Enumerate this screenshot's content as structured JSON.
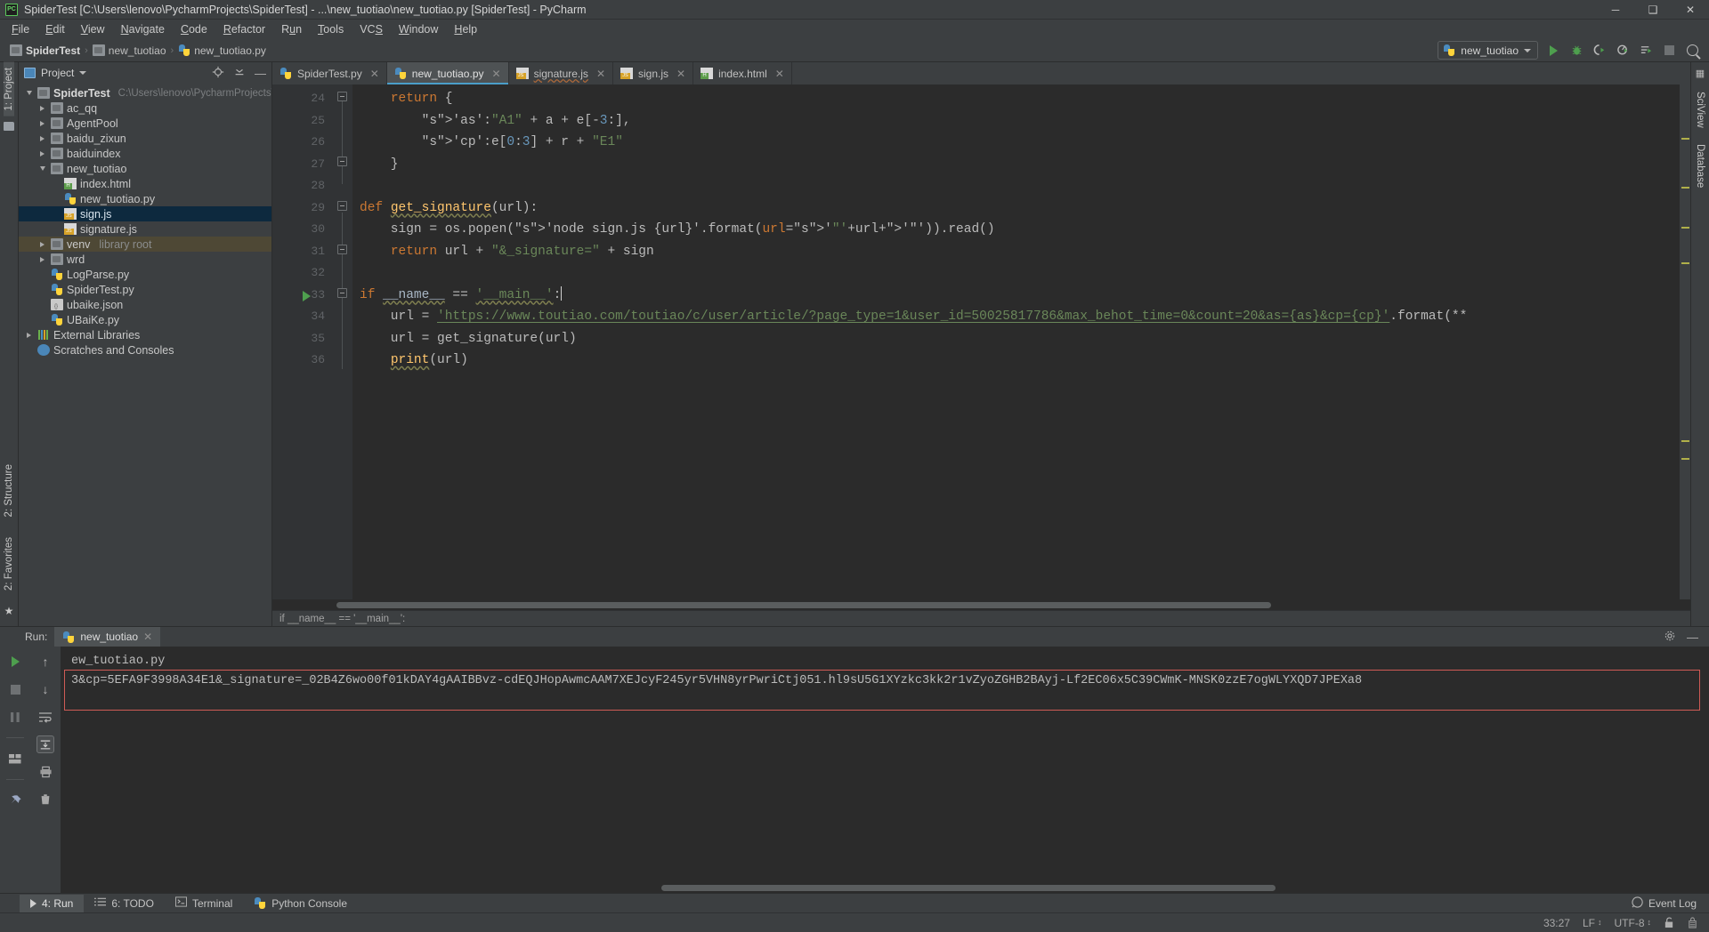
{
  "window": {
    "title": "SpiderTest [C:\\Users\\lenovo\\PycharmProjects\\SpiderTest] - ...\\new_tuotiao\\new_tuotiao.py [SpiderTest] - PyCharm",
    "minimize": "─",
    "maximize": "❑",
    "close": "✕",
    "logo": "PC"
  },
  "menu": {
    "items": [
      "File",
      "Edit",
      "View",
      "Navigate",
      "Code",
      "Refactor",
      "Run",
      "Tools",
      "VCS",
      "Window",
      "Help"
    ]
  },
  "navbar": {
    "crumbs": [
      "SpiderTest",
      "new_tuotiao",
      "new_tuotiao.py"
    ],
    "separator": "›",
    "run_config": "new_tuotiao"
  },
  "project_panel": {
    "title": "Project",
    "tree": [
      {
        "label": "SpiderTest",
        "path": "C:\\Users\\lenovo\\PycharmProjects\\SpiderT",
        "indent": 0,
        "arrow": "down",
        "icon": "folder",
        "bold": true
      },
      {
        "label": "ac_qq",
        "indent": 1,
        "arrow": "right",
        "icon": "folder"
      },
      {
        "label": "AgentPool",
        "indent": 1,
        "arrow": "right",
        "icon": "folder"
      },
      {
        "label": "baidu_zixun",
        "indent": 1,
        "arrow": "right",
        "icon": "folder"
      },
      {
        "label": "baiduindex",
        "indent": 1,
        "arrow": "right",
        "icon": "folder"
      },
      {
        "label": "new_tuotiao",
        "indent": 1,
        "arrow": "down",
        "icon": "folder"
      },
      {
        "label": "index.html",
        "indent": 2,
        "arrow": "none",
        "icon": "html"
      },
      {
        "label": "new_tuotiao.py",
        "indent": 2,
        "arrow": "none",
        "icon": "py"
      },
      {
        "label": "sign.js",
        "indent": 2,
        "arrow": "none",
        "icon": "js",
        "selected": true
      },
      {
        "label": "signature.js",
        "indent": 2,
        "arrow": "none",
        "icon": "js"
      },
      {
        "label": "venv",
        "sub": "library root",
        "indent": 1,
        "arrow": "right",
        "icon": "folder",
        "highlight": true
      },
      {
        "label": "wrd",
        "indent": 1,
        "arrow": "right",
        "icon": "folder"
      },
      {
        "label": "LogParse.py",
        "indent": 1,
        "arrow": "none",
        "icon": "py"
      },
      {
        "label": "SpiderTest.py",
        "indent": 1,
        "arrow": "none",
        "icon": "py"
      },
      {
        "label": "ubaike.json",
        "indent": 1,
        "arrow": "none",
        "icon": "json"
      },
      {
        "label": "UBaiKe.py",
        "indent": 1,
        "arrow": "none",
        "icon": "py"
      },
      {
        "label": "External Libraries",
        "indent": 0,
        "arrow": "right",
        "icon": "lib"
      },
      {
        "label": "Scratches and Consoles",
        "indent": 0,
        "arrow": "none",
        "icon": "scratch"
      }
    ]
  },
  "left_strip": {
    "project_tab": "1: Project",
    "structure_tab": "2: Structure",
    "favorites_tab": "2: Favorites"
  },
  "right_strip": {
    "sciview_tab": "SciView",
    "database_tab": "Database"
  },
  "editor": {
    "tabs": [
      {
        "label": "SpiderTest.py",
        "icon": "py",
        "active": false
      },
      {
        "label": "new_tuotiao.py",
        "icon": "py",
        "active": true
      },
      {
        "label": "signature.js",
        "icon": "js",
        "active": false,
        "wavy": true
      },
      {
        "label": "sign.js",
        "icon": "js",
        "active": false
      },
      {
        "label": "index.html",
        "icon": "html",
        "active": false
      }
    ],
    "first_line_number": 24,
    "lines": [
      {
        "num": 24,
        "text": "    return {"
      },
      {
        "num": 25,
        "text": "        'as':\"A1\" + a + e[-3:],"
      },
      {
        "num": 26,
        "text": "        'cp':e[0:3] + r + \"E1\""
      },
      {
        "num": 27,
        "text": "    }"
      },
      {
        "num": 28,
        "text": ""
      },
      {
        "num": 29,
        "text": "def get_signature(url):"
      },
      {
        "num": 30,
        "text": "    sign = os.popen('node sign.js {url}'.format(url='\"'+url+'\"')).read()"
      },
      {
        "num": 31,
        "text": "    return url + \"&_signature=\" + sign"
      },
      {
        "num": 32,
        "text": ""
      },
      {
        "num": 33,
        "text": "if __name__ == '__main__':"
      },
      {
        "num": 34,
        "text": "    url = 'https://www.toutiao.com/toutiao/c/user/article/?page_type=1&user_id=50025817786&max_behot_time=0&count=20&as={as}&cp={cp}'.format(**"
      },
      {
        "num": 35,
        "text": "    url = get_signature(url)"
      },
      {
        "num": 36,
        "text": "    print(url)"
      }
    ],
    "breadcrumb_bottom": "if __name__ == '__main__':"
  },
  "run_window": {
    "label": "Run:",
    "tab_title": "new_tuotiao",
    "close": "✕",
    "console_line_1": "ew_tuotiao.py",
    "console_line_2": "3&cp=5EFA9F3998A34E1&_signature=_02B4Z6wo00f01kDAY4gAAIBBvz-cdEQJHopAwmcAAM7XEJcyF245yr5VHN8yrPwriCtj051.hl9sU5G1XYzkc3kk2r1vZyoZGHB2BAyj-Lf2EC06x5C39CWmK-MNSK0zzE7ogWLYXQD7JPEXa8"
  },
  "bottom_tools": {
    "tabs": [
      {
        "label": "4: Run",
        "icon": "play",
        "selected": true
      },
      {
        "label": "6: TODO",
        "icon": "list",
        "selected": false
      },
      {
        "label": "Terminal",
        "icon": "terminal",
        "selected": false
      },
      {
        "label": "Python Console",
        "icon": "python",
        "selected": false
      }
    ],
    "event_log": "Event Log"
  },
  "status_bar": {
    "caret_position": "33:27",
    "line_separator": "LF",
    "encoding": "UTF-8",
    "updown": "↕"
  }
}
